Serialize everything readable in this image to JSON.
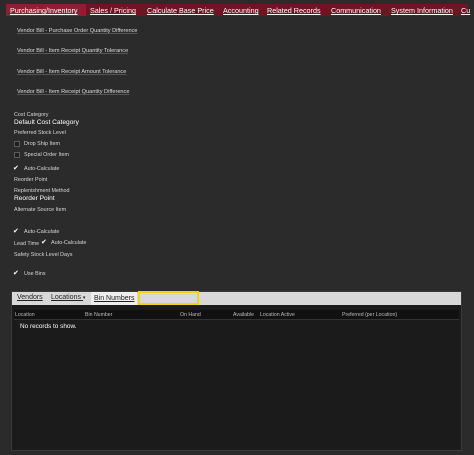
{
  "tabs": [
    {
      "label": "Purchasing/Inventory",
      "active": true
    },
    {
      "label": "Sales / Pricing",
      "active": false
    },
    {
      "label": "Calculate Base Price",
      "active": false
    },
    {
      "label": "Accounting",
      "active": false
    },
    {
      "label": "Related Records",
      "active": false
    },
    {
      "label": "Communication",
      "active": false
    },
    {
      "label": "System Information",
      "active": false
    },
    {
      "label": "Cu",
      "active": false
    }
  ],
  "subtabs": [
    "Vendor Bill - Purchase Order Quantity Difference",
    "Vendor Bill - Item Receipt Quantity Tolerance",
    "Vendor Bill - Item Receipt Amount Tolerance",
    "Vendor Bill - Item Receipt Quantity Difference"
  ],
  "fields": {
    "cost_category_label": "Cost Category",
    "cost_category_value": "Default Cost Category",
    "preferred_stock_level_label": "Preferred Stock Level",
    "drop_ship_label": "Drop Ship Item",
    "drop_ship_checked": false,
    "special_order_label": "Special Order Item",
    "special_order_checked": false,
    "auto_calc_1_label": "Auto-Calculate",
    "auto_calc_1_checked": true,
    "reorder_point_label": "Reorder Point",
    "replenishment_method_label": "Replenishment Method",
    "replenishment_method_value": "Reorder Point",
    "alternate_source_label": "Alternate Source Item",
    "auto_calc_2_label": "Auto-Calculate",
    "auto_calc_2_checked": true,
    "lead_time_label": "Lead Time",
    "auto_calc_3_label": "Auto-Calculate",
    "auto_calc_3_checked": true,
    "safety_stock_label": "Safety Stock Level Days",
    "use_bins_label": "Use Bins",
    "use_bins_checked": true
  },
  "sublist": {
    "tabs": {
      "vendors": "Vendors",
      "locations": "Locations",
      "locations_caret": "▾",
      "bin_numbers": "Bin Numbers"
    },
    "columns": [
      "Location",
      "Bin Number",
      "On Hand",
      "Available",
      "Location Active",
      "Preferred (per Location)"
    ],
    "empty_message": "No records to show."
  },
  "colors": {
    "tab_active": "#8e1f33",
    "tab_inactive": "#6f1424",
    "background": "#2b2b2b",
    "highlight": "#f2d21b"
  }
}
